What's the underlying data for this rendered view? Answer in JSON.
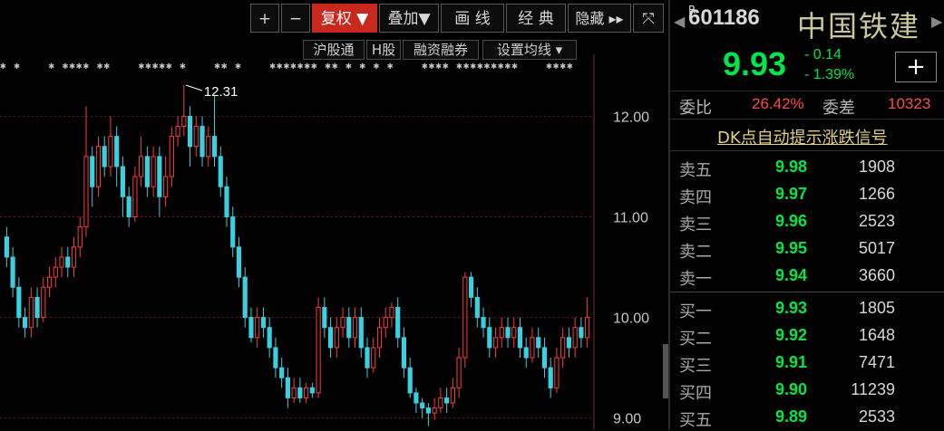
{
  "toolbar": {
    "plus": "+",
    "minus": "−",
    "fuquan": "复权 ▼",
    "diejia": "叠加▼",
    "huaxian": "画 线",
    "jingdian": "经 典",
    "yincang": "隐藏 ▸▸",
    "fullscreen": "⤧"
  },
  "subtoolbar": {
    "hgt": "沪股通",
    "hgu": "H股",
    "rzrq": "融资融券",
    "junxian": "设置均线 ▾"
  },
  "marks_row": "✱ ✱    ✱ ✱✱✱✱ ✱✱    ✱✱✱✱✱ ✱    ✱✱ ✱    ✱✱✱✱✱✱✱ ✱✱ ✱ ✱ ✱ ✱    ✱✱✱✱ ✱✱✱✱✱✱✱✱✱    ✱✱✱✱",
  "chart_data": {
    "type": "candlestick",
    "ylim": [
      8.88,
      12.4
    ],
    "yticks": [
      "12.00",
      "11.00",
      "10.00",
      "9.00"
    ],
    "peak_annotation": "12.31",
    "up_color": "#ff3b3b",
    "down_color": "#39d0e0",
    "candles": [
      [
        10.8,
        10.6,
        10.9,
        10.5
      ],
      [
        10.6,
        10.3,
        10.7,
        10.2
      ],
      [
        10.3,
        10.0,
        10.4,
        9.9
      ],
      [
        10.0,
        9.9,
        10.1,
        9.8
      ],
      [
        9.9,
        10.2,
        10.3,
        9.8
      ],
      [
        10.2,
        10.0,
        10.3,
        9.9
      ],
      [
        10.0,
        10.3,
        10.4,
        9.95
      ],
      [
        10.3,
        10.4,
        10.5,
        10.2
      ],
      [
        10.4,
        10.5,
        10.6,
        10.3
      ],
      [
        10.5,
        10.6,
        10.7,
        10.4
      ],
      [
        10.6,
        10.5,
        10.7,
        10.4
      ],
      [
        10.5,
        10.7,
        10.8,
        10.4
      ],
      [
        10.7,
        10.9,
        11.0,
        10.6
      ],
      [
        10.9,
        11.6,
        12.1,
        10.8
      ],
      [
        11.6,
        11.3,
        11.7,
        11.1
      ],
      [
        11.3,
        11.7,
        11.8,
        11.2
      ],
      [
        11.7,
        11.5,
        11.8,
        11.4
      ],
      [
        11.5,
        11.8,
        12.0,
        11.4
      ],
      [
        11.8,
        11.5,
        11.9,
        11.3
      ],
      [
        11.5,
        11.2,
        11.6,
        11.0
      ],
      [
        11.2,
        11.0,
        11.3,
        10.9
      ],
      [
        11.0,
        11.4,
        11.5,
        10.95
      ],
      [
        11.4,
        11.6,
        11.8,
        11.3
      ],
      [
        11.6,
        11.3,
        11.7,
        11.2
      ],
      [
        11.3,
        11.6,
        11.7,
        11.2
      ],
      [
        11.6,
        11.2,
        11.7,
        11.0
      ],
      [
        11.2,
        11.4,
        11.6,
        11.1
      ],
      [
        11.4,
        11.8,
        11.9,
        11.3
      ],
      [
        11.8,
        11.9,
        12.0,
        11.7
      ],
      [
        11.9,
        12.0,
        12.31,
        11.8
      ],
      [
        12.0,
        11.7,
        12.1,
        11.5
      ],
      [
        11.7,
        11.9,
        12.0,
        11.6
      ],
      [
        11.9,
        11.6,
        12.0,
        11.5
      ],
      [
        11.6,
        11.8,
        11.9,
        11.5
      ],
      [
        11.8,
        11.6,
        12.2,
        11.5
      ],
      [
        11.6,
        11.3,
        11.7,
        11.2
      ],
      [
        11.3,
        11.0,
        11.4,
        10.9
      ],
      [
        11.0,
        10.7,
        11.1,
        10.6
      ],
      [
        10.7,
        10.4,
        10.8,
        10.3
      ],
      [
        10.4,
        10.0,
        10.5,
        9.9
      ],
      [
        10.0,
        9.8,
        10.1,
        9.75
      ],
      [
        9.8,
        10.0,
        10.1,
        9.7
      ],
      [
        10.0,
        9.9,
        10.1,
        9.8
      ],
      [
        9.9,
        9.7,
        10.0,
        9.6
      ],
      [
        9.7,
        9.5,
        9.8,
        9.4
      ],
      [
        9.5,
        9.4,
        9.6,
        9.3
      ],
      [
        9.4,
        9.2,
        9.5,
        9.1
      ],
      [
        9.2,
        9.3,
        9.4,
        9.15
      ],
      [
        9.3,
        9.2,
        9.4,
        9.15
      ],
      [
        9.2,
        9.3,
        9.35,
        9.15
      ],
      [
        9.3,
        9.25,
        9.35,
        9.2
      ],
      [
        9.25,
        10.1,
        10.2,
        9.2
      ],
      [
        10.1,
        9.9,
        10.2,
        9.8
      ],
      [
        9.9,
        9.7,
        10.0,
        9.6
      ],
      [
        9.7,
        9.9,
        10.0,
        9.6
      ],
      [
        9.9,
        10.0,
        10.1,
        9.8
      ],
      [
        10.0,
        9.8,
        10.1,
        9.7
      ],
      [
        9.8,
        10.0,
        10.1,
        9.7
      ],
      [
        10.0,
        9.7,
        10.1,
        9.6
      ],
      [
        9.7,
        9.5,
        9.8,
        9.4
      ],
      [
        9.5,
        9.7,
        9.8,
        9.45
      ],
      [
        9.7,
        9.9,
        10.0,
        9.6
      ],
      [
        9.9,
        10.0,
        10.1,
        9.8
      ],
      [
        10.0,
        10.1,
        10.15,
        9.9
      ],
      [
        10.1,
        9.8,
        10.2,
        9.7
      ],
      [
        9.8,
        9.5,
        9.9,
        9.4
      ],
      [
        9.5,
        9.25,
        9.6,
        9.2
      ],
      [
        9.25,
        9.15,
        9.3,
        9.05
      ],
      [
        9.15,
        9.1,
        9.2,
        9.0
      ],
      [
        9.1,
        9.05,
        9.15,
        8.92
      ],
      [
        9.05,
        9.1,
        9.2,
        8.98
      ],
      [
        9.1,
        9.2,
        9.3,
        9.05
      ],
      [
        9.2,
        9.15,
        9.3,
        9.05
      ],
      [
        9.15,
        9.3,
        9.4,
        9.1
      ],
      [
        9.3,
        9.6,
        9.7,
        9.2
      ],
      [
        9.6,
        10.4,
        10.45,
        9.5
      ],
      [
        10.4,
        10.2,
        10.45,
        10.1
      ],
      [
        10.2,
        10.0,
        10.3,
        9.9
      ],
      [
        10.0,
        9.9,
        10.1,
        9.8
      ],
      [
        9.9,
        9.7,
        10.0,
        9.6
      ],
      [
        9.7,
        9.8,
        9.9,
        9.6
      ],
      [
        9.8,
        9.9,
        10.0,
        9.7
      ],
      [
        9.9,
        9.8,
        10.0,
        9.7
      ],
      [
        9.8,
        9.9,
        10.0,
        9.7
      ],
      [
        9.9,
        9.7,
        10.0,
        9.6
      ],
      [
        9.7,
        9.6,
        9.8,
        9.5
      ],
      [
        9.6,
        9.8,
        9.9,
        9.55
      ],
      [
        9.8,
        9.7,
        9.9,
        9.6
      ],
      [
        9.7,
        9.5,
        9.8,
        9.4
      ],
      [
        9.5,
        9.3,
        9.6,
        9.2
      ],
      [
        9.3,
        9.6,
        9.7,
        9.25
      ],
      [
        9.6,
        9.8,
        9.9,
        9.5
      ],
      [
        9.8,
        9.7,
        9.9,
        9.6
      ],
      [
        9.7,
        9.9,
        10.0,
        9.6
      ],
      [
        9.9,
        9.8,
        10.0,
        9.7
      ],
      [
        9.8,
        10.0,
        10.2,
        9.7
      ]
    ]
  },
  "quote": {
    "code_mark": "R",
    "code": "601186",
    "name": "中国铁建",
    "price": "9.93",
    "change": "- 0.14",
    "change_pct": "- 1.39%",
    "add_btn": "+",
    "weibi_label": "委比",
    "weibi_value": "26.42%",
    "weicha_label": "委差",
    "weicha_value": "10323",
    "dk_link": "DK点自动提示涨跌信号",
    "sell": [
      {
        "label": "卖五",
        "price": "9.98",
        "vol": "1908"
      },
      {
        "label": "卖四",
        "price": "9.97",
        "vol": "1266"
      },
      {
        "label": "卖三",
        "price": "9.96",
        "vol": "2523"
      },
      {
        "label": "卖二",
        "price": "9.95",
        "vol": "5017"
      },
      {
        "label": "卖一",
        "price": "9.94",
        "vol": "3660"
      }
    ],
    "buy": [
      {
        "label": "买一",
        "price": "9.93",
        "vol": "1805"
      },
      {
        "label": "买二",
        "price": "9.92",
        "vol": "1648"
      },
      {
        "label": "买三",
        "price": "9.91",
        "vol": "7471"
      },
      {
        "label": "买四",
        "price": "9.90",
        "vol": "11239"
      },
      {
        "label": "买五",
        "price": "9.89",
        "vol": "2533"
      }
    ]
  }
}
